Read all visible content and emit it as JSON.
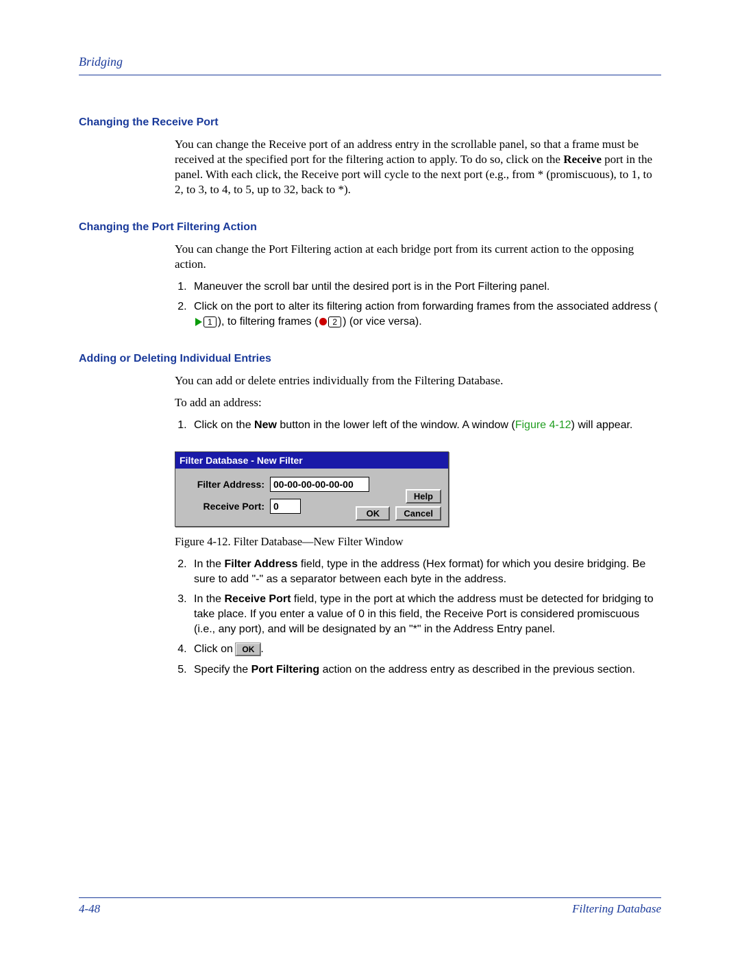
{
  "header": {
    "title": "Bridging"
  },
  "sections": {
    "s1": {
      "heading": "Changing the Receive Port",
      "para": "You can change the Receive port of an address entry in the scrollable panel, so that a frame must be received at the specified port for the filtering action to apply. To do so, click on the Receive port in the panel. With each click, the Receive port will cycle to the next port (e.g., from * (promiscuous), to 1, to 2, to 3, to 4, to 5, up to 32, back to *).",
      "bold_word": "Receive"
    },
    "s2": {
      "heading": "Changing the Port Filtering Action",
      "para": "You can change the Port Filtering action at each bridge port from its current action to the opposing action.",
      "step1": "Maneuver the scroll bar until the desired port is in the Port Filtering panel.",
      "step2a": "Click on the port to alter its filtering action from forwarding frames from the associated address (",
      "step2b": "), to filtering frames (",
      "step2c": ") (or vice versa)."
    },
    "s3": {
      "heading": "Adding or Deleting Individual Entries",
      "para1": "You can add or delete entries individually from the Filtering Database.",
      "para2": "To add an address:",
      "step1a": "Click on the ",
      "step1_bold": "New",
      "step1b": " button in the lower left of the window. A window (",
      "step1_fig": "Figure 4-12",
      "step1c": ") will appear.",
      "dialog": {
        "title": "Filter Database - New Filter",
        "lbl_addr": "Filter Address:",
        "val_addr": "00-00-00-00-00-00",
        "lbl_port": "Receive Port:",
        "val_port": "0",
        "btn_help": "Help",
        "btn_ok": "OK",
        "btn_cancel": "Cancel"
      },
      "caption": "Figure 4-12. Filter Database—New Filter Window",
      "step2a": "In the ",
      "step2_bold": "Filter Address",
      "step2b": " field, type in the address (Hex format) for which you desire bridging. Be sure to add \"-\" as a separator between each byte in the address.",
      "step3a": "In the ",
      "step3_bold": "Receive Port",
      "step3b": " field, type in the port at which the address must be detected for bridging to take place. If you enter a value of 0 in this field, the Receive Port is considered promiscuous (i.e., any port), and will be designated by an \"*\" in the Address Entry panel.",
      "step4a": "Click on ",
      "step4_ok": "OK",
      "step4b": ".",
      "step5a": "Specify the ",
      "step5_bold": "Port Filtering",
      "step5b": " action on the address entry as described in the previous section."
    }
  },
  "footer": {
    "page": "4-48",
    "section": "Filtering Database"
  },
  "icons": {
    "num1": "1",
    "num2": "2"
  }
}
